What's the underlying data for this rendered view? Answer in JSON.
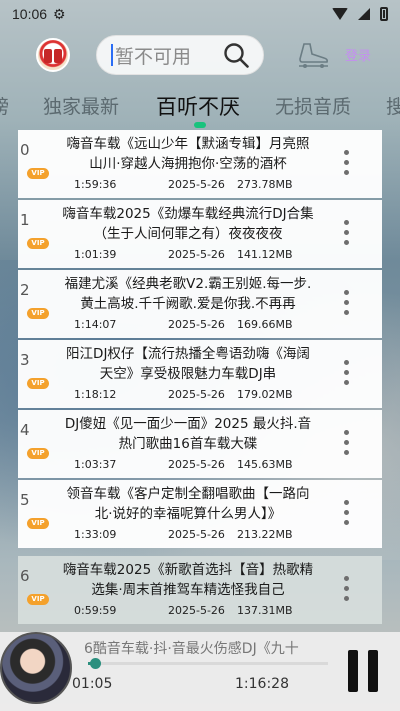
{
  "status_bar": {
    "time": "10:06"
  },
  "search": {
    "placeholder": "暂不可用"
  },
  "header": {
    "login_label": "登录"
  },
  "tabs": [
    {
      "label": "榜"
    },
    {
      "label": "独家最新"
    },
    {
      "label": "百听不厌",
      "active": true
    },
    {
      "label": "无损音质"
    },
    {
      "label": "搜"
    }
  ],
  "songs": [
    {
      "index": "0",
      "badge": "VIP",
      "title": "嗨音车载《远山少年【默涵专辑】月亮照山川·穿越人海拥抱你·空荡的酒杯",
      "duration": "1:59:36",
      "date": "2025-5-26",
      "size": "273.78MB"
    },
    {
      "index": "1",
      "badge": "VIP",
      "title": "嗨音车载2025《劲爆车载经典流行DJ合集（生于人间何罪之有）夜夜夜夜",
      "duration": "1:01:39",
      "date": "2025-5-26",
      "size": "141.12MB"
    },
    {
      "index": "2",
      "badge": "VIP",
      "title": "福建尤溪《经典老歌V2.霸王别姬.每一步.黄土高坡.千千阙歌.爱是你我.不再再",
      "duration": "1:14:07",
      "date": "2025-5-26",
      "size": "169.66MB"
    },
    {
      "index": "3",
      "badge": "VIP",
      "title": "阳江DJ权仔【流行热播全粤语劲嗨《海阔天空》享受极限魅力车载DJ串",
      "duration": "1:18:12",
      "date": "2025-5-26",
      "size": "179.02MB"
    },
    {
      "index": "4",
      "badge": "VIP",
      "title": "DJ傻妞《见一面少一面》2025 最火抖.音 热门歌曲16首车载大碟",
      "duration": "1:03:37",
      "date": "2025-5-26",
      "size": "145.63MB"
    },
    {
      "index": "5",
      "badge": "VIP",
      "title": "领音车载《客户定制全翻唱歌曲【一路向北·说好的幸福呢算什么男人】》",
      "duration": "1:33:09",
      "date": "2025-5-26",
      "size": "213.22MB"
    },
    {
      "index": "6",
      "badge": "VIP",
      "title": "嗨音车载2025《新歌首选抖【音】热歌精选集·周末首推驾车精选怪我自己",
      "duration": "0:59:59",
      "date": "2025-5-26",
      "size": "137.31MB",
      "playing": true
    }
  ],
  "player": {
    "now_playing": "6酷音车载·抖·音最火伤感DJ《九十",
    "current_time": "01:05",
    "total_time": "1:16:28",
    "progress": 0.014
  },
  "colors": {
    "accent": "#19c37d",
    "vip": "#f4a12c",
    "progress": "#2b8f7e",
    "login": "#c48ef0"
  }
}
